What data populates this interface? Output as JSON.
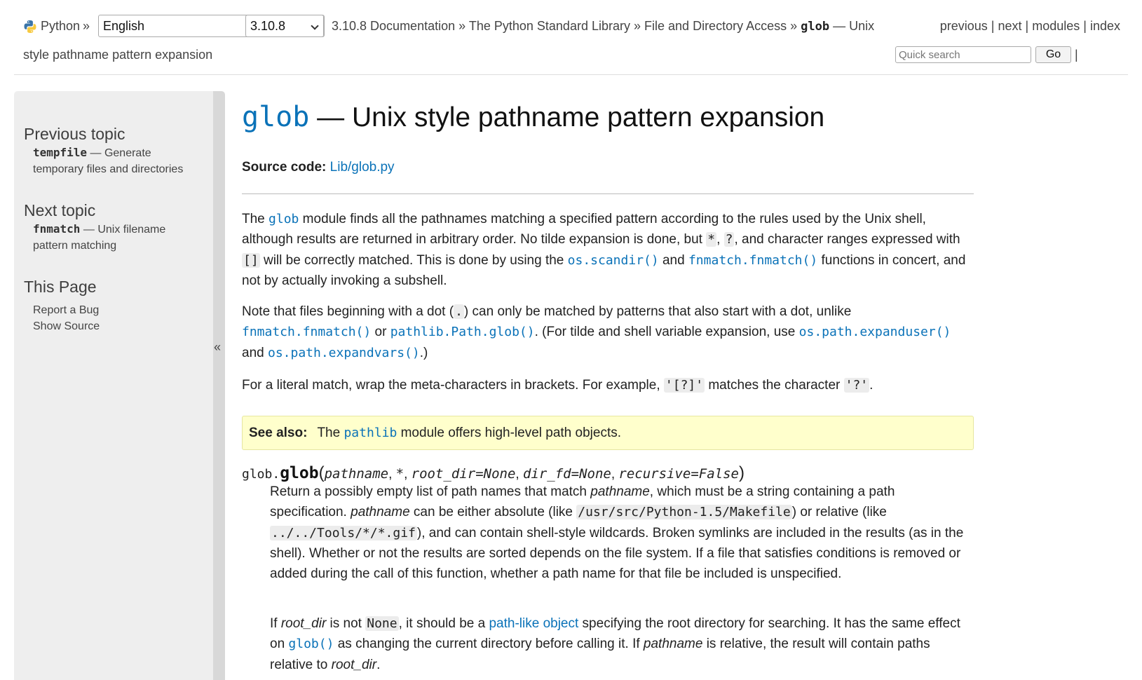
{
  "header": {
    "python_link": "Python",
    "sep1": "»",
    "language_value": "English",
    "version_value": "3.10.8",
    "breadcrumb": {
      "docs": "3.10.8 Documentation",
      "sep_a": "»",
      "stdlib": "The Python Standard Library",
      "sep_b": "»",
      "fileaccess": "File and Directory Access",
      "sep_c": "»",
      "module": "glob",
      "title_head": "— Unix",
      "title_tail": "style pathname pattern expansion"
    },
    "nav": {
      "previous": "previous",
      "next": "next",
      "modules": "modules",
      "index": "index",
      "pipe": "|"
    },
    "search_placeholder": "Quick search",
    "go_label": "Go"
  },
  "sidebar": {
    "previous_heading": "Previous topic",
    "previous_module": "tempfile",
    "previous_desc": "— Generate temporary files and directories",
    "next_heading": "Next topic",
    "next_module": "fnmatch",
    "next_desc": "— Unix filename pattern matching",
    "thispage_heading": "This Page",
    "report_bug": "Report a Bug",
    "show_source": "Show Source",
    "collapse_glyph": "«"
  },
  "main": {
    "h1_module": "glob",
    "h1_rest": " — Unix style pathname pattern expansion",
    "source_label": "Source code:",
    "source_link": "Lib/glob.py",
    "p1": {
      "t1": "The ",
      "glob": "glob",
      "t2": " module finds all the pathnames matching a specified pattern according to the rules used by the Unix shell, although results are returned in arbitrary order. No tilde expansion is done, but ",
      "star": "*",
      "t3": ", ",
      "q": "?",
      "t4": ", and character ranges expressed with ",
      "br": "[]",
      "t5": " will be correctly matched. This is done by using the ",
      "scandir": "os.scandir()",
      "t6": " and ",
      "fnmatch": "fnmatch.fnmatch()",
      "t7": " functions in concert, and not by actually invoking a subshell."
    },
    "p2": {
      "t1": "Note that files beginning with a dot (",
      "dot": ".",
      "t2": ") can only be matched by patterns that also start with a dot, unlike ",
      "fnmatch": "fnmatch.fnmatch()",
      "t3": " or ",
      "pathglob": "pathlib.Path.glob()",
      "t4": ". (For tilde and shell variable expansion, use ",
      "expanduser": "os.path.expanduser()",
      "t5": " and ",
      "expandvars": "os.path.expandvars()",
      "t6": ".)"
    },
    "p3": {
      "t1": "For a literal match, wrap the meta-characters in brackets. For example, ",
      "lit1": "'[?]'",
      "t2": " matches the character ",
      "lit2": "'?'",
      "t3": "."
    },
    "seealso": {
      "label": "See also:",
      "t1": "The ",
      "pathlib": "pathlib",
      "t2": " module offers high-level path objects."
    },
    "signature": {
      "prefix": "glob.",
      "name": "glob",
      "open": "(",
      "a1": "pathname",
      "c1": ", ",
      "a2": "*",
      "c2": ", ",
      "a3": "root_dir",
      "eq": "=",
      "v3": "None",
      "c3": ", ",
      "a4": "dir_fd",
      "v4": "None",
      "c4": ", ",
      "a5": "recursive",
      "v5": "False",
      "close": ")"
    },
    "d1": {
      "t1": "Return a possibly empty list of path names that match ",
      "em1": "pathname",
      "t2": ", which must be a string containing a path specification. ",
      "em2": "pathname",
      "t3": " can be either absolute (like ",
      "c1": "/usr/src/Python-1.5/Makefile",
      "t4": ") or relative (like ",
      "c2": "../../Tools/*/*.gif",
      "t5": "), and can contain shell-style wildcards. Broken symlinks are included in the results (as in the shell). Whether or not the results are sorted depends on the file system. If a file that satisfies conditions is removed or added during the call of this function, whether a path name for that file be included is unspecified."
    },
    "d2": {
      "t1": "If ",
      "em1": "root_dir",
      "t2": " is not ",
      "none": "None",
      "t3": ", it should be a ",
      "link": "path-like object",
      "t4": " specifying the root directory for searching. It has the same effect on ",
      "glob": "glob()",
      "t5": " as changing the current directory before calling it. If ",
      "em2": "pathname",
      "t6": " is relative, the result will contain paths relative to ",
      "em3": "root_dir",
      "t7": "."
    }
  },
  "colors": {
    "link": "#0a72b8",
    "sidebar_bg": "#eeeeee",
    "seealso_bg": "#ffffcc"
  }
}
